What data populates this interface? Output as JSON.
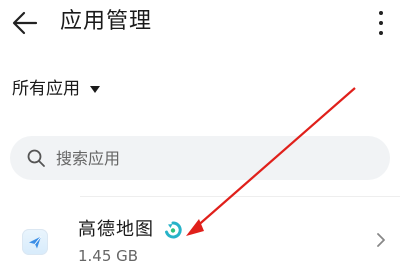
{
  "header": {
    "title": "应用管理",
    "back_icon": "arrow-left-icon",
    "more_icon": "more-vertical-icon"
  },
  "filter": {
    "label": "所有应用",
    "caret_icon": "caret-down-icon"
  },
  "search": {
    "placeholder": "搜索应用",
    "value": "",
    "icon": "search-icon"
  },
  "apps": [
    {
      "name": "高德地图",
      "size": "1.45 GB",
      "icon": "app-icon",
      "badge_icon": "app-badge-icon"
    }
  ],
  "colors": {
    "accent_arrow": "#e0201b",
    "search_bg": "#f1f3f5",
    "secondary_text": "#666666"
  }
}
